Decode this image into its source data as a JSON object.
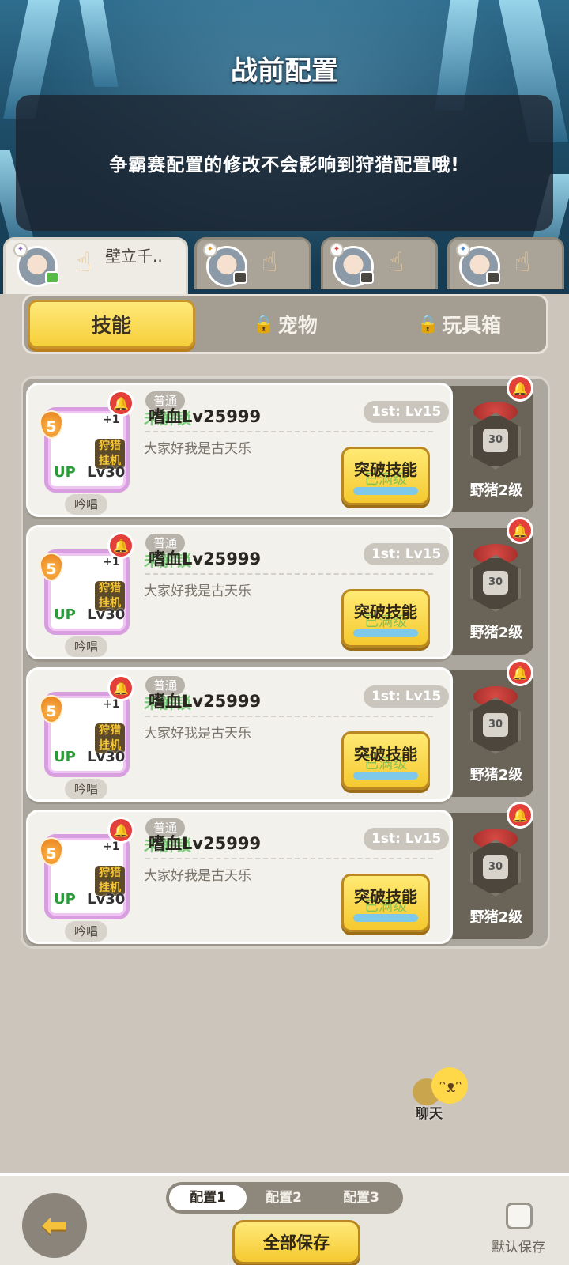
{
  "header": {
    "title": "战前配置",
    "notice": "争霸赛配置的修改不会影响到狩猎配置哦!"
  },
  "characters": [
    {
      "name": "壁立千..",
      "active": true
    },
    {
      "name": "",
      "active": false
    },
    {
      "name": "",
      "active": false
    },
    {
      "name": "",
      "active": false
    }
  ],
  "categories": {
    "skills": "技能",
    "pets": "宠物",
    "toybox": "玩具箱"
  },
  "skills": [
    {
      "level": "5",
      "plus": "+1",
      "tag": "狩猎挂机",
      "up": "UP",
      "lv": "Lv30",
      "chant": "吟唱",
      "type": "普通",
      "ghost": "未解锁",
      "name": "嗜血Lv25999",
      "rank": "1st: Lv15",
      "desc": "大家好我是古天乐",
      "button": "突破技能",
      "maxed": "已满级",
      "unlock_level": "30",
      "unlock_label": "野猪2级"
    },
    {
      "level": "5",
      "plus": "+1",
      "tag": "狩猎挂机",
      "up": "UP",
      "lv": "Lv30",
      "chant": "吟唱",
      "type": "普通",
      "ghost": "未解锁",
      "name": "嗜血Lv25999",
      "rank": "1st: Lv15",
      "desc": "大家好我是古天乐",
      "button": "突破技能",
      "maxed": "已满级",
      "unlock_level": "30",
      "unlock_label": "野猪2级"
    },
    {
      "level": "5",
      "plus": "+1",
      "tag": "狩猎挂机",
      "up": "UP",
      "lv": "Lv30",
      "chant": "吟唱",
      "type": "普通",
      "ghost": "未解锁",
      "name": "嗜血Lv25999",
      "rank": "1st: Lv15",
      "desc": "大家好我是古天乐",
      "button": "突破技能",
      "maxed": "已满级",
      "unlock_level": "30",
      "unlock_label": "野猪2级"
    },
    {
      "level": "5",
      "plus": "+1",
      "tag": "狩猎挂机",
      "up": "UP",
      "lv": "Lv30",
      "chant": "吟唱",
      "type": "普通",
      "ghost": "未解锁",
      "name": "嗜血Lv25999",
      "rank": "1st: Lv15",
      "desc": "大家好我是古天乐",
      "button": "突破技能",
      "maxed": "已满级",
      "unlock_level": "30",
      "unlock_label": "野猪2级"
    }
  ],
  "chat": {
    "label": "聊天"
  },
  "footer": {
    "presets": [
      "配置1",
      "配置2",
      "配置3"
    ],
    "save_all": "全部保存",
    "default_save": "默认保存"
  },
  "colors": {
    "accent_yellow": "#f5c92f",
    "bell_red": "#e3403a",
    "frame_purple": "#d99ee0",
    "banner_blue": "#1d4c66"
  }
}
